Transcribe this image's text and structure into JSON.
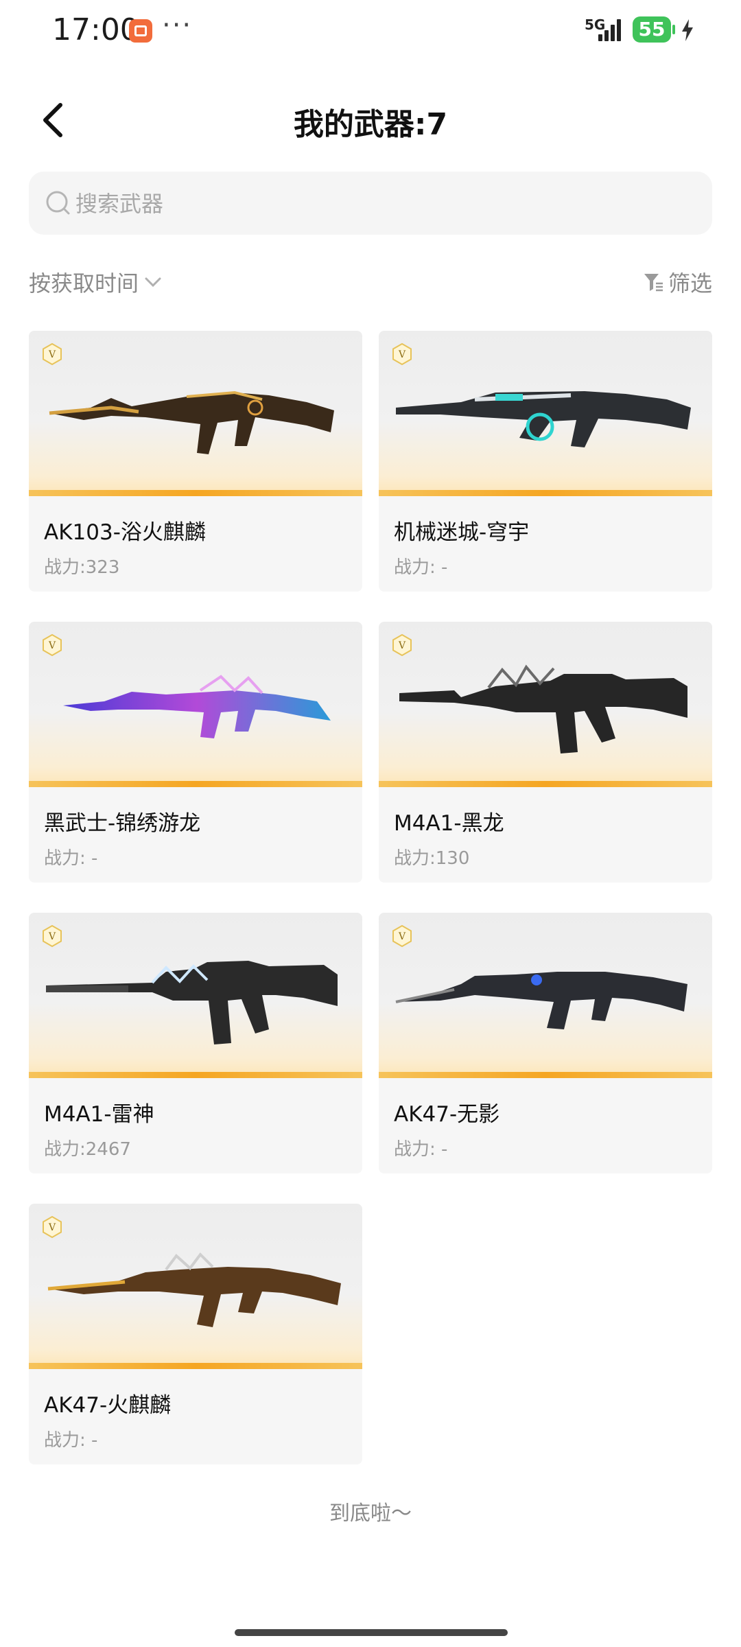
{
  "status": {
    "time": "17:00",
    "dots": "···",
    "network": "5G",
    "battery": "55"
  },
  "header": {
    "title": "我的武器:7"
  },
  "search": {
    "placeholder": "搜索武器",
    "value": ""
  },
  "sort": {
    "label": "按获取时间"
  },
  "filter": {
    "label": "筛选"
  },
  "weapons": [
    {
      "name": "AK103-浴火麒麟",
      "power": "战力:323",
      "badge": "V"
    },
    {
      "name": "机械迷城-穹宇",
      "power": "战力: -",
      "badge": "V"
    },
    {
      "name": "黑武士-锦绣游龙",
      "power": "战力: -",
      "badge": "V"
    },
    {
      "name": "M4A1-黑龙",
      "power": "战力:130",
      "badge": "V"
    },
    {
      "name": "M4A1-雷神",
      "power": "战力:2467",
      "badge": "V"
    },
    {
      "name": "AK47-无影",
      "power": "战力: -",
      "badge": "V"
    },
    {
      "name": "AK47-火麒麟",
      "power": "战力: -",
      "badge": "V"
    }
  ],
  "footer": {
    "end_text": "到底啦～"
  },
  "colors": {
    "accent": "#f5a623",
    "battery": "#3fc35a",
    "card_bg": "#f6f6f6"
  }
}
